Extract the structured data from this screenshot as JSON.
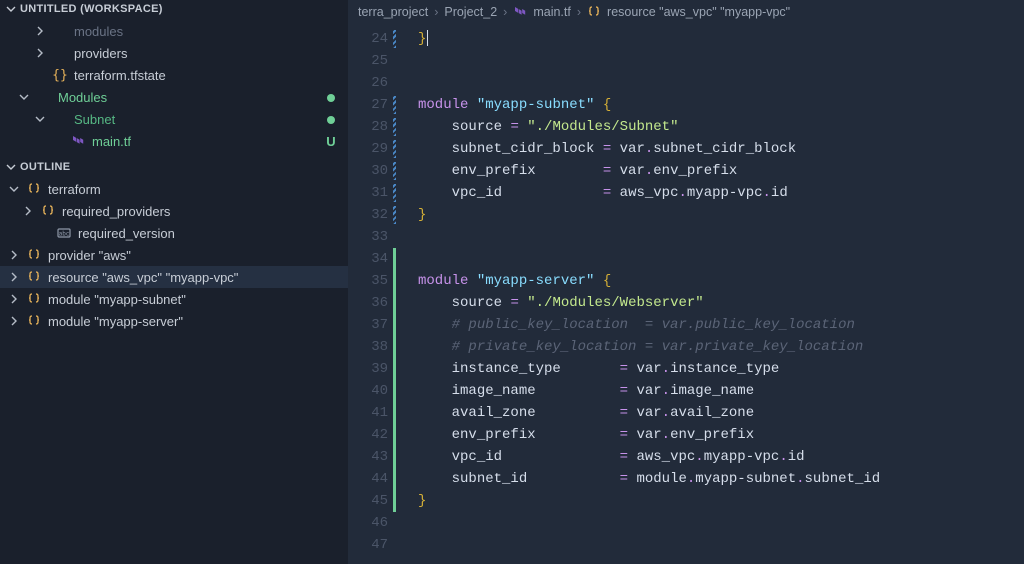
{
  "explorer": {
    "title": "UNTITLED (WORKSPACE)",
    "items": [
      {
        "label": "modules",
        "indent": 28,
        "chev": "right",
        "dim": true,
        "icon": ""
      },
      {
        "label": "providers",
        "indent": 28,
        "chev": "right",
        "icon": ""
      },
      {
        "label": "terraform.tfstate",
        "indent": 28,
        "icon": "braces"
      },
      {
        "label": "Modules",
        "indent": 12,
        "chev": "down",
        "green": true,
        "tail": "dot"
      },
      {
        "label": "Subnet",
        "indent": 28,
        "chev": "down",
        "greenish": true,
        "tail": "dot"
      },
      {
        "label": "main.tf",
        "indent": 46,
        "icon": "tf",
        "green": true,
        "tail": "U"
      }
    ]
  },
  "outline": {
    "title": "OUTLINE",
    "items": [
      {
        "label": "terraform",
        "indent": 2,
        "chev": "down",
        "icon": "sym"
      },
      {
        "label": "required_providers",
        "indent": 16,
        "chev": "right",
        "icon": "sym"
      },
      {
        "label": "required_version",
        "indent": 32,
        "icon": "str"
      },
      {
        "label": "provider \"aws\"",
        "indent": 2,
        "chev": "right",
        "icon": "sym"
      },
      {
        "label": "resource \"aws_vpc\" \"myapp-vpc\"",
        "indent": 2,
        "chev": "right",
        "icon": "sym",
        "selected": true
      },
      {
        "label": "module \"myapp-subnet\"",
        "indent": 2,
        "chev": "right",
        "icon": "sym"
      },
      {
        "label": "module \"myapp-server\"",
        "indent": 2,
        "chev": "right",
        "icon": "sym"
      }
    ]
  },
  "breadcrumbs": {
    "parts": [
      "terra_project",
      "Project_2",
      "main.tf",
      "resource \"aws_vpc\" \"myapp-vpc\""
    ],
    "icons": [
      "",
      "",
      "tf",
      "sym"
    ]
  },
  "editor": {
    "first_line": 24,
    "lines": [
      {
        "n": 24,
        "diff": "blue",
        "html": "<span class='tok-brace'>}</span><span class='cursor'></span>"
      },
      {
        "n": 25,
        "html": ""
      },
      {
        "n": 26,
        "html": ""
      },
      {
        "n": 27,
        "diff": "blue",
        "html": "<span class='tok-kw'>module</span> <span class='tok-str'>\"myapp-subnet\"</span> <span class='tok-brace'>{</span>"
      },
      {
        "n": 28,
        "diff": "blue",
        "html": "    <span class='tok-attr'>source</span> <span class='tok-op'>=</span> <span class='tok-str2'>\"./Modules/Subnet\"</span>"
      },
      {
        "n": 29,
        "diff": "blue",
        "html": "    <span class='tok-attr'>subnet_cidr_block</span> <span class='tok-op'>=</span> <span class='tok-var'>var</span><span class='tok-dot'>.</span><span class='tok-var'>subnet_cidr_block</span>"
      },
      {
        "n": 30,
        "diff": "blue",
        "html": "    <span class='tok-attr'>env_prefix</span>        <span class='tok-op'>=</span> <span class='tok-var'>var</span><span class='tok-dot'>.</span><span class='tok-var'>env_prefix</span>"
      },
      {
        "n": 31,
        "diff": "blue",
        "html": "    <span class='tok-attr'>vpc_id</span>            <span class='tok-op'>=</span> <span class='tok-var'>aws_vpc</span><span class='tok-dot'>.</span><span class='tok-var'>myapp-vpc</span><span class='tok-dot'>.</span><span class='tok-var'>id</span>"
      },
      {
        "n": 32,
        "diff": "blue",
        "html": "<span class='tok-brace'>}</span>"
      },
      {
        "n": 33,
        "html": ""
      },
      {
        "n": 34,
        "diff": "green",
        "html": ""
      },
      {
        "n": 35,
        "diff": "green",
        "html": "<span class='tok-kw'>module</span> <span class='tok-str'>\"myapp-server\"</span> <span class='tok-brace'>{</span>"
      },
      {
        "n": 36,
        "diff": "green",
        "html": "    <span class='tok-attr'>source</span> <span class='tok-op'>=</span> <span class='tok-str2'>\"./Modules/Webserver\"</span>"
      },
      {
        "n": 37,
        "diff": "green",
        "html": "    <span class='tok-cmt'># public_key_location  = var.public_key_location</span>"
      },
      {
        "n": 38,
        "diff": "green",
        "html": "    <span class='tok-cmt'># private_key_location = var.private_key_location</span>"
      },
      {
        "n": 39,
        "diff": "green",
        "html": "    <span class='tok-attr'>instance_type</span>       <span class='tok-op'>=</span> <span class='tok-var'>var</span><span class='tok-dot'>.</span><span class='tok-var'>instance_type</span>"
      },
      {
        "n": 40,
        "diff": "green",
        "html": "    <span class='tok-attr'>image_name</span>          <span class='tok-op'>=</span> <span class='tok-var'>var</span><span class='tok-dot'>.</span><span class='tok-var'>image_name</span>"
      },
      {
        "n": 41,
        "diff": "green",
        "html": "    <span class='tok-attr'>avail_zone</span>          <span class='tok-op'>=</span> <span class='tok-var'>var</span><span class='tok-dot'>.</span><span class='tok-var'>avail_zone</span>"
      },
      {
        "n": 42,
        "diff": "green",
        "html": "    <span class='tok-attr'>env_prefix</span>          <span class='tok-op'>=</span> <span class='tok-var'>var</span><span class='tok-dot'>.</span><span class='tok-var'>env_prefix</span>"
      },
      {
        "n": 43,
        "diff": "green",
        "html": "    <span class='tok-attr'>vpc_id</span>              <span class='tok-op'>=</span> <span class='tok-var'>aws_vpc</span><span class='tok-dot'>.</span><span class='tok-var'>myapp-vpc</span><span class='tok-dot'>.</span><span class='tok-var'>id</span>"
      },
      {
        "n": 44,
        "diff": "green",
        "html": "    <span class='tok-attr'>subnet_id</span>           <span class='tok-op'>=</span> <span class='tok-var'>module</span><span class='tok-dot'>.</span><span class='tok-var'>myapp-subnet</span><span class='tok-dot'>.</span><span class='tok-var'>subnet_id</span>"
      },
      {
        "n": 45,
        "diff": "green",
        "html": "<span class='tok-brace'>}</span>"
      },
      {
        "n": 46,
        "html": ""
      },
      {
        "n": 47,
        "html": ""
      }
    ]
  }
}
